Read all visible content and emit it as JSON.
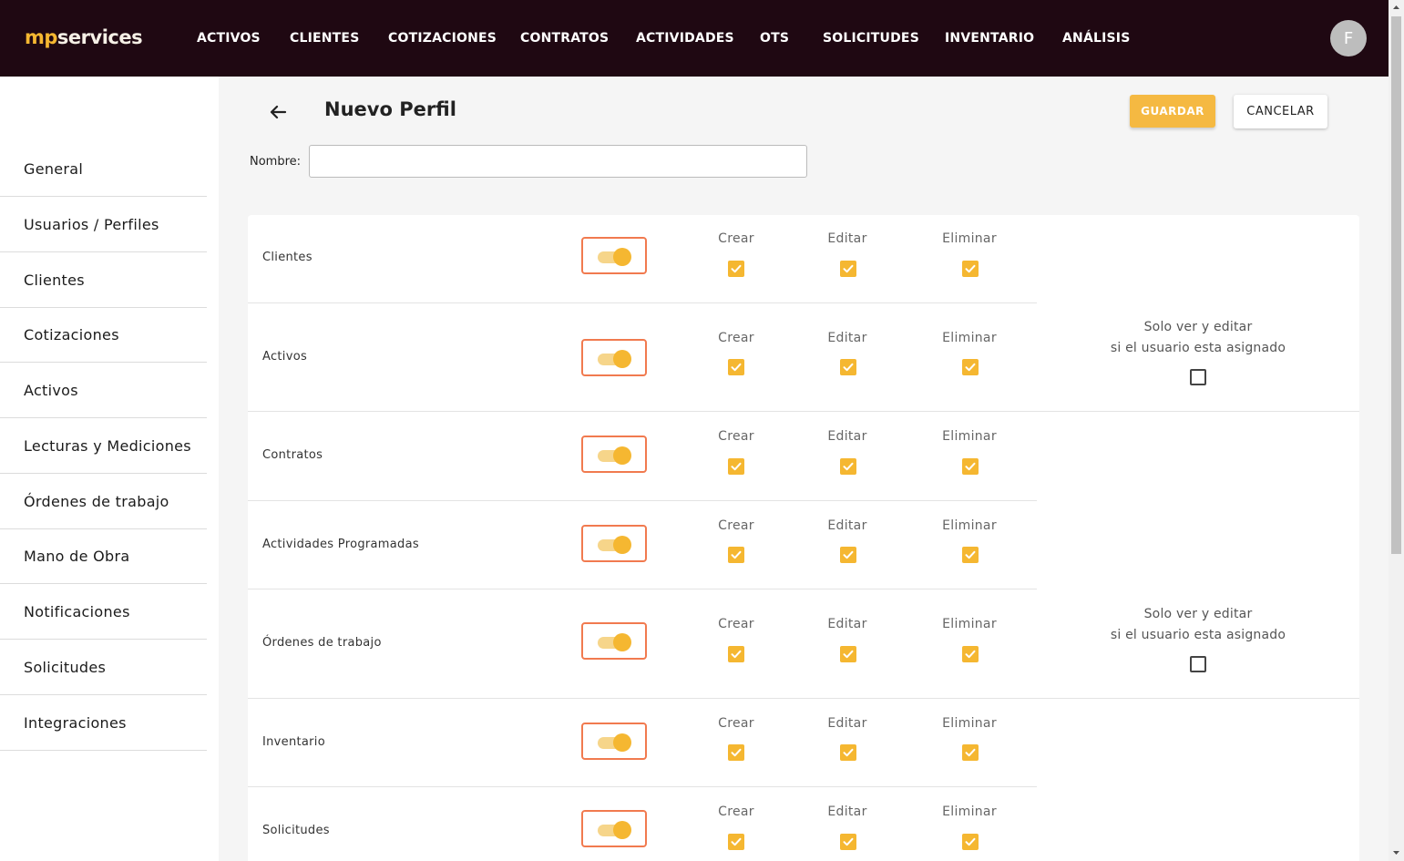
{
  "brand": {
    "logo_prefix": "mp",
    "logo_suffix": "services",
    "accent": "#f5b731",
    "nav_bg": "#1f0812"
  },
  "nav": {
    "items": [
      "ACTIVOS",
      "CLIENTES",
      "COTIZACIONES",
      "CONTRATOS",
      "ACTIVIDADES",
      "OTS",
      "SOLICITUDES",
      "INVENTARIO",
      "ANÁLISIS"
    ],
    "avatar_initial": "F"
  },
  "sidebar": {
    "items": [
      "General",
      "Usuarios / Perfiles",
      "Clientes",
      "Cotizaciones",
      "Activos",
      "Lecturas y Mediciones",
      "Órdenes de trabajo",
      "Mano de Obra",
      "Notificaciones",
      "Solicitudes",
      "Integraciones"
    ]
  },
  "header": {
    "title": "Nuevo Perfil",
    "save_label": "GUARDAR",
    "cancel_label": "CANCELAR",
    "name_label": "Nombre:",
    "name_value": ""
  },
  "permissions": {
    "crear_label": "Crear",
    "editar_label": "Editar",
    "eliminar_label": "Eliminar",
    "assigned_line1": "Solo ver y editar",
    "assigned_line2": "si el usuario esta asignado",
    "modules": [
      {
        "name": "Clientes",
        "enabled": true,
        "crear": true,
        "editar": true,
        "eliminar": true
      },
      {
        "name": "Activos",
        "enabled": true,
        "crear": true,
        "editar": true,
        "eliminar": true,
        "only_assigned": false
      },
      {
        "name": "Contratos",
        "enabled": true,
        "crear": true,
        "editar": true,
        "eliminar": true
      },
      {
        "name": "Actividades Programadas",
        "enabled": true,
        "crear": true,
        "editar": true,
        "eliminar": true
      },
      {
        "name": "Órdenes de trabajo",
        "enabled": true,
        "crear": true,
        "editar": true,
        "eliminar": true,
        "only_assigned": false
      },
      {
        "name": "Inventario",
        "enabled": true,
        "crear": true,
        "editar": true,
        "eliminar": true
      },
      {
        "name": "Solicitudes",
        "enabled": true,
        "crear": true,
        "editar": true,
        "eliminar": true
      }
    ]
  }
}
